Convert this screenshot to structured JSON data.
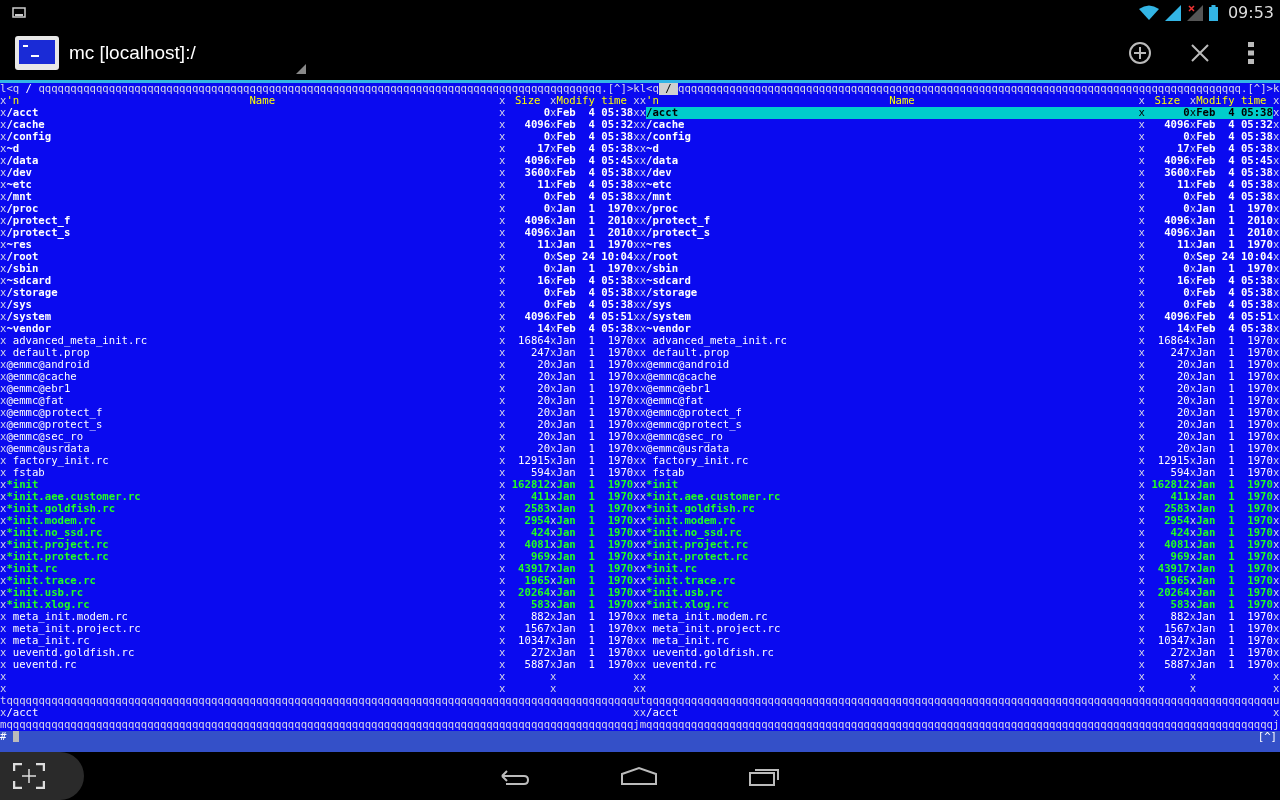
{
  "status_bar": {
    "time": "09:53"
  },
  "app_bar": {
    "title": "mc [localhost]:/"
  },
  "panels": [
    {
      "active": false,
      "top": {
        "start": "l<q",
        "path": "/",
        "rule": "qqqqqqqqqqqqqqqqqqqqqqqqqqqqqqqqqqqqqqqqqqqqqqqqqqqqqqqqqqqqqqqqqqqqqqqqqqqqqqqqqqqqqqqq",
        "end": ".[^]>k"
      },
      "heading": {
        "frame": [
          "x",
          "x",
          "x",
          "x"
        ],
        "sort": "'n",
        "name": "Name",
        "size": "Size",
        "modify": "Modify time"
      },
      "rows": [
        {
          "frame": [
            "x",
            "x",
            "x",
            "x"
          ],
          "name": "/acct",
          "size": "0",
          "date": "Feb  4 05:38",
          "kind": "dir",
          "selected": false
        },
        {
          "frame": [
            "x",
            "x",
            "x",
            "x"
          ],
          "name": "/cache",
          "size": "4096",
          "date": "Feb  4 05:32",
          "kind": "dir",
          "selected": false
        },
        {
          "frame": [
            "x",
            "x",
            "x",
            "x"
          ],
          "name": "/config",
          "size": "0",
          "date": "Feb  4 05:38",
          "kind": "dir",
          "selected": false
        },
        {
          "frame": [
            "x",
            "x",
            "x",
            "x"
          ],
          "name": "~d",
          "size": "17",
          "date": "Feb  4 05:38",
          "kind": "link",
          "selected": false
        },
        {
          "frame": [
            "x",
            "x",
            "x",
            "x"
          ],
          "name": "/data",
          "size": "4096",
          "date": "Feb  4 05:45",
          "kind": "dir",
          "selected": false
        },
        {
          "frame": [
            "x",
            "x",
            "x",
            "x"
          ],
          "name": "/dev",
          "size": "3600",
          "date": "Feb  4 05:38",
          "kind": "dir",
          "selected": false
        },
        {
          "frame": [
            "x",
            "x",
            "x",
            "x"
          ],
          "name": "~etc",
          "size": "11",
          "date": "Feb  4 05:38",
          "kind": "link",
          "selected": false
        },
        {
          "frame": [
            "x",
            "x",
            "x",
            "x"
          ],
          "name": "/mnt",
          "size": "0",
          "date": "Feb  4 05:38",
          "kind": "dir",
          "selected": false
        },
        {
          "frame": [
            "x",
            "x",
            "x",
            "x"
          ],
          "name": "/proc",
          "size": "0",
          "date": "Jan  1  1970",
          "kind": "dir",
          "selected": false
        },
        {
          "frame": [
            "x",
            "x",
            "x",
            "x"
          ],
          "name": "/protect_f",
          "size": "4096",
          "date": "Jan  1  2010",
          "kind": "dir",
          "selected": false
        },
        {
          "frame": [
            "x",
            "x",
            "x",
            "x"
          ],
          "name": "/protect_s",
          "size": "4096",
          "date": "Jan  1  2010",
          "kind": "dir",
          "selected": false
        },
        {
          "frame": [
            "x",
            "x",
            "x",
            "x"
          ],
          "name": "~res",
          "size": "11",
          "date": "Jan  1  1970",
          "kind": "link",
          "selected": false
        },
        {
          "frame": [
            "x",
            "x",
            "x",
            "x"
          ],
          "name": "/root",
          "size": "0",
          "date": "Sep 24 10:04",
          "kind": "dir",
          "selected": false
        },
        {
          "frame": [
            "x",
            "x",
            "x",
            "x"
          ],
          "name": "/sbin",
          "size": "0",
          "date": "Jan  1  1970",
          "kind": "dir",
          "selected": false
        },
        {
          "frame": [
            "x",
            "x",
            "x",
            "x"
          ],
          "name": "~sdcard",
          "size": "16",
          "date": "Feb  4 05:38",
          "kind": "link",
          "selected": false
        },
        {
          "frame": [
            "x",
            "x",
            "x",
            "x"
          ],
          "name": "/storage",
          "size": "0",
          "date": "Feb  4 05:38",
          "kind": "dir",
          "selected": false
        },
        {
          "frame": [
            "x",
            "x",
            "x",
            "x"
          ],
          "name": "/sys",
          "size": "0",
          "date": "Feb  4 05:38",
          "kind": "dir",
          "selected": false
        },
        {
          "frame": [
            "x",
            "x",
            "x",
            "x"
          ],
          "name": "/system",
          "size": "4096",
          "date": "Feb  4 05:51",
          "kind": "dir",
          "selected": false
        },
        {
          "frame": [
            "x",
            "x",
            "x",
            "x"
          ],
          "name": "~vendor",
          "size": "14",
          "date": "Feb  4 05:38",
          "kind": "link",
          "selected": false
        },
        {
          "frame": [
            "x",
            "x",
            "x",
            "x"
          ],
          "name": "advanced_meta_init.rc",
          "size": "16864",
          "date": "Jan  1  1970",
          "kind": "file",
          "selected": false
        },
        {
          "frame": [
            "x",
            "x",
            "x",
            "x"
          ],
          "name": "default.prop",
          "size": "247",
          "date": "Jan  1  1970",
          "kind": "file",
          "selected": false
        },
        {
          "frame": [
            "x",
            "x",
            "x",
            "x"
          ],
          "name": "@emmc@android",
          "size": "20",
          "date": "Jan  1  1970",
          "kind": "device",
          "selected": false
        },
        {
          "frame": [
            "x",
            "x",
            "x",
            "x"
          ],
          "name": "@emmc@cache",
          "size": "20",
          "date": "Jan  1  1970",
          "kind": "device",
          "selected": false
        },
        {
          "frame": [
            "x",
            "x",
            "x",
            "x"
          ],
          "name": "@emmc@ebr1",
          "size": "20",
          "date": "Jan  1  1970",
          "kind": "device",
          "selected": false
        },
        {
          "frame": [
            "x",
            "x",
            "x",
            "x"
          ],
          "name": "@emmc@fat",
          "size": "20",
          "date": "Jan  1  1970",
          "kind": "device",
          "selected": false
        },
        {
          "frame": [
            "x",
            "x",
            "x",
            "x"
          ],
          "name": "@emmc@protect_f",
          "size": "20",
          "date": "Jan  1  1970",
          "kind": "device",
          "selected": false
        },
        {
          "frame": [
            "x",
            "x",
            "x",
            "x"
          ],
          "name": "@emmc@protect_s",
          "size": "20",
          "date": "Jan  1  1970",
          "kind": "device",
          "selected": false
        },
        {
          "frame": [
            "x",
            "x",
            "x",
            "x"
          ],
          "name": "@emmc@sec_ro",
          "size": "20",
          "date": "Jan  1  1970",
          "kind": "device",
          "selected": false
        },
        {
          "frame": [
            "x",
            "x",
            "x",
            "x"
          ],
          "name": "@emmc@usrdata",
          "size": "20",
          "date": "Jan  1  1970",
          "kind": "device",
          "selected": false
        },
        {
          "frame": [
            "x",
            "x",
            "x",
            "x"
          ],
          "name": "factory_init.rc",
          "size": "12915",
          "date": "Jan  1  1970",
          "kind": "file",
          "selected": false
        },
        {
          "frame": [
            "x",
            "x",
            "x",
            "x"
          ],
          "name": "fstab",
          "size": "594",
          "date": "Jan  1  1970",
          "kind": "file",
          "selected": false
        },
        {
          "frame": [
            "x",
            "x",
            "x",
            "x"
          ],
          "name": "*init",
          "size": "162812",
          "date": "Jan  1  1970",
          "kind": "exec",
          "selected": false
        },
        {
          "frame": [
            "x",
            "x",
            "x",
            "x"
          ],
          "name": "*init.aee.customer.rc",
          "size": "411",
          "date": "Jan  1  1970",
          "kind": "exec",
          "selected": false
        },
        {
          "frame": [
            "x",
            "x",
            "x",
            "x"
          ],
          "name": "*init.goldfish.rc",
          "size": "2583",
          "date": "Jan  1  1970",
          "kind": "exec",
          "selected": false
        },
        {
          "frame": [
            "x",
            "x",
            "x",
            "x"
          ],
          "name": "*init.modem.rc",
          "size": "2954",
          "date": "Jan  1  1970",
          "kind": "exec",
          "selected": false
        },
        {
          "frame": [
            "x",
            "x",
            "x",
            "x"
          ],
          "name": "*init.no_ssd.rc",
          "size": "424",
          "date": "Jan  1  1970",
          "kind": "exec",
          "selected": false
        },
        {
          "frame": [
            "x",
            "x",
            "x",
            "x"
          ],
          "name": "*init.project.rc",
          "size": "4081",
          "date": "Jan  1  1970",
          "kind": "exec",
          "selected": false
        },
        {
          "frame": [
            "x",
            "x",
            "x",
            "x"
          ],
          "name": "*init.protect.rc",
          "size": "969",
          "date": "Jan  1  1970",
          "kind": "exec",
          "selected": false
        },
        {
          "frame": [
            "x",
            "x",
            "x",
            "x"
          ],
          "name": "*init.rc",
          "size": "43917",
          "date": "Jan  1  1970",
          "kind": "exec",
          "selected": false
        },
        {
          "frame": [
            "x",
            "x",
            "x",
            "x"
          ],
          "name": "*init.trace.rc",
          "size": "1965",
          "date": "Jan  1  1970",
          "kind": "exec",
          "selected": false
        },
        {
          "frame": [
            "x",
            "x",
            "x",
            "x"
          ],
          "name": "*init.usb.rc",
          "size": "20264",
          "date": "Jan  1  1970",
          "kind": "exec",
          "selected": false
        },
        {
          "frame": [
            "x",
            "x",
            "x",
            "x"
          ],
          "name": "*init.xlog.rc",
          "size": "583",
          "date": "Jan  1  1970",
          "kind": "exec",
          "selected": false
        },
        {
          "frame": [
            "x",
            "x",
            "x",
            "x"
          ],
          "name": "meta_init.modem.rc",
          "size": "882",
          "date": "Jan  1  1970",
          "kind": "file",
          "selected": false
        },
        {
          "frame": [
            "x",
            "x",
            "x",
            "x"
          ],
          "name": "meta_init.project.rc",
          "size": "1567",
          "date": "Jan  1  1970",
          "kind": "file",
          "selected": false
        },
        {
          "frame": [
            "x",
            "x",
            "x",
            "x"
          ],
          "name": "meta_init.rc",
          "size": "10347",
          "date": "Jan  1  1970",
          "kind": "file",
          "selected": false
        },
        {
          "frame": [
            "x",
            "x",
            "x",
            "x"
          ],
          "name": "ueventd.goldfish.rc",
          "size": "272",
          "date": "Jan  1  1970",
          "kind": "file",
          "selected": false
        },
        {
          "frame": [
            "x",
            "x",
            "x",
            "x"
          ],
          "name": "ueventd.rc",
          "size": "5887",
          "date": "Jan  1  1970",
          "kind": "file",
          "selected": false
        }
      ],
      "blank_rows": [
        {
          "frame": [
            "x",
            "x",
            "x",
            "x"
          ]
        },
        {
          "frame": [
            "x",
            "x",
            "x",
            "x"
          ]
        }
      ],
      "divider": {
        "start": "t",
        "rule": "qqqqqqqqqqqqqqqqqqqqqqqqqqqqqqqqqqqqqqqqqqqqqqqqqqqqqqqqqqqqqqqqqqqqqqqqqqqqqqqqqqqqqqqqqqqqqqqqqq",
        "end": "u"
      },
      "info": {
        "frame": [
          "x",
          "x"
        ],
        "text": "/acct"
      },
      "bottom": {
        "start": "m",
        "rule": "qqqqqqqqqqqqqqqqqqqqqqqqqqqqqqqqqqqqqqqqqqqqqqqqqqqqqqqqqqqqqqqqqqqqqqqqqqqqqqqqqqqqqqqqqqqqqqqqqq",
        "end": "j"
      }
    },
    {
      "active": true,
      "top": {
        "start": "l<q",
        "path": "/",
        "rule": "qqqqqqqqqqqqqqqqqqqqqqqqqqqqqqqqqqqqqqqqqqqqqqqqqqqqqqqqqqqqqqqqqqqqqqqqqqqqqqqqqqqqqqqq",
        "end": ".[^]>k"
      },
      "heading": {
        "frame": [
          "x",
          "x",
          "x",
          "x"
        ],
        "sort": "'n",
        "name": "Name",
        "size": "Size",
        "modify": "Modify time"
      },
      "rows": [
        {
          "frame": [
            "x",
            "x",
            "x",
            "x"
          ],
          "name": "/acct",
          "size": "0",
          "date": "Feb  4 05:38",
          "kind": "dir",
          "selected": true
        },
        {
          "frame": [
            "x",
            "x",
            "x",
            "x"
          ],
          "name": "/cache",
          "size": "4096",
          "date": "Feb  4 05:32",
          "kind": "dir",
          "selected": false
        },
        {
          "frame": [
            "x",
            "x",
            "x",
            "x"
          ],
          "name": "/config",
          "size": "0",
          "date": "Feb  4 05:38",
          "kind": "dir",
          "selected": false
        },
        {
          "frame": [
            "x",
            "x",
            "x",
            "x"
          ],
          "name": "~d",
          "size": "17",
          "date": "Feb  4 05:38",
          "kind": "link",
          "selected": false
        },
        {
          "frame": [
            "x",
            "x",
            "x",
            "x"
          ],
          "name": "/data",
          "size": "4096",
          "date": "Feb  4 05:45",
          "kind": "dir",
          "selected": false
        },
        {
          "frame": [
            "x",
            "x",
            "x",
            "x"
          ],
          "name": "/dev",
          "size": "3600",
          "date": "Feb  4 05:38",
          "kind": "dir",
          "selected": false
        },
        {
          "frame": [
            "x",
            "x",
            "x",
            "x"
          ],
          "name": "~etc",
          "size": "11",
          "date": "Feb  4 05:38",
          "kind": "link",
          "selected": false
        },
        {
          "frame": [
            "x",
            "x",
            "x",
            "x"
          ],
          "name": "/mnt",
          "size": "0",
          "date": "Feb  4 05:38",
          "kind": "dir",
          "selected": false
        },
        {
          "frame": [
            "x",
            "x",
            "x",
            "x"
          ],
          "name": "/proc",
          "size": "0",
          "date": "Jan  1  1970",
          "kind": "dir",
          "selected": false
        },
        {
          "frame": [
            "x",
            "x",
            "x",
            "x"
          ],
          "name": "/protect_f",
          "size": "4096",
          "date": "Jan  1  2010",
          "kind": "dir",
          "selected": false
        },
        {
          "frame": [
            "x",
            "x",
            "x",
            "x"
          ],
          "name": "/protect_s",
          "size": "4096",
          "date": "Jan  1  2010",
          "kind": "dir",
          "selected": false
        },
        {
          "frame": [
            "x",
            "x",
            "x",
            "x"
          ],
          "name": "~res",
          "size": "11",
          "date": "Jan  1  1970",
          "kind": "link",
          "selected": false
        },
        {
          "frame": [
            "x",
            "x",
            "x",
            "x"
          ],
          "name": "/root",
          "size": "0",
          "date": "Sep 24 10:04",
          "kind": "dir",
          "selected": false
        },
        {
          "frame": [
            "x",
            "x",
            "x",
            "x"
          ],
          "name": "/sbin",
          "size": "0",
          "date": "Jan  1  1970",
          "kind": "dir",
          "selected": false
        },
        {
          "frame": [
            "x",
            "x",
            "x",
            "x"
          ],
          "name": "~sdcard",
          "size": "16",
          "date": "Feb  4 05:38",
          "kind": "link",
          "selected": false
        },
        {
          "frame": [
            "x",
            "x",
            "x",
            "x"
          ],
          "name": "/storage",
          "size": "0",
          "date": "Feb  4 05:38",
          "kind": "dir",
          "selected": false
        },
        {
          "frame": [
            "x",
            "x",
            "x",
            "x"
          ],
          "name": "/sys",
          "size": "0",
          "date": "Feb  4 05:38",
          "kind": "dir",
          "selected": false
        },
        {
          "frame": [
            "x",
            "x",
            "x",
            "x"
          ],
          "name": "/system",
          "size": "4096",
          "date": "Feb  4 05:51",
          "kind": "dir",
          "selected": false
        },
        {
          "frame": [
            "x",
            "x",
            "x",
            "x"
          ],
          "name": "~vendor",
          "size": "14",
          "date": "Feb  4 05:38",
          "kind": "link",
          "selected": false
        },
        {
          "frame": [
            "x",
            "x",
            "x",
            "x"
          ],
          "name": "advanced_meta_init.rc",
          "size": "16864",
          "date": "Jan  1  1970",
          "kind": "file",
          "selected": false
        },
        {
          "frame": [
            "x",
            "x",
            "x",
            "x"
          ],
          "name": "default.prop",
          "size": "247",
          "date": "Jan  1  1970",
          "kind": "file",
          "selected": false
        },
        {
          "frame": [
            "x",
            "x",
            "x",
            "x"
          ],
          "name": "@emmc@android",
          "size": "20",
          "date": "Jan  1  1970",
          "kind": "device",
          "selected": false
        },
        {
          "frame": [
            "x",
            "x",
            "x",
            "x"
          ],
          "name": "@emmc@cache",
          "size": "20",
          "date": "Jan  1  1970",
          "kind": "device",
          "selected": false
        },
        {
          "frame": [
            "x",
            "x",
            "x",
            "x"
          ],
          "name": "@emmc@ebr1",
          "size": "20",
          "date": "Jan  1  1970",
          "kind": "device",
          "selected": false
        },
        {
          "frame": [
            "x",
            "x",
            "x",
            "x"
          ],
          "name": "@emmc@fat",
          "size": "20",
          "date": "Jan  1  1970",
          "kind": "device",
          "selected": false
        },
        {
          "frame": [
            "x",
            "x",
            "x",
            "x"
          ],
          "name": "@emmc@protect_f",
          "size": "20",
          "date": "Jan  1  1970",
          "kind": "device",
          "selected": false
        },
        {
          "frame": [
            "x",
            "x",
            "x",
            "x"
          ],
          "name": "@emmc@protect_s",
          "size": "20",
          "date": "Jan  1  1970",
          "kind": "device",
          "selected": false
        },
        {
          "frame": [
            "x",
            "x",
            "x",
            "x"
          ],
          "name": "@emmc@sec_ro",
          "size": "20",
          "date": "Jan  1  1970",
          "kind": "device",
          "selected": false
        },
        {
          "frame": [
            "x",
            "x",
            "x",
            "x"
          ],
          "name": "@emmc@usrdata",
          "size": "20",
          "date": "Jan  1  1970",
          "kind": "device",
          "selected": false
        },
        {
          "frame": [
            "x",
            "x",
            "x",
            "x"
          ],
          "name": "factory_init.rc",
          "size": "12915",
          "date": "Jan  1  1970",
          "kind": "file",
          "selected": false
        },
        {
          "frame": [
            "x",
            "x",
            "x",
            "x"
          ],
          "name": "fstab",
          "size": "594",
          "date": "Jan  1  1970",
          "kind": "file",
          "selected": false
        },
        {
          "frame": [
            "x",
            "x",
            "x",
            "x"
          ],
          "name": "*init",
          "size": "162812",
          "date": "Jan  1  1970",
          "kind": "exec",
          "selected": false
        },
        {
          "frame": [
            "x",
            "x",
            "x",
            "x"
          ],
          "name": "*init.aee.customer.rc",
          "size": "411",
          "date": "Jan  1  1970",
          "kind": "exec",
          "selected": false
        },
        {
          "frame": [
            "x",
            "x",
            "x",
            "x"
          ],
          "name": "*init.goldfish.rc",
          "size": "2583",
          "date": "Jan  1  1970",
          "kind": "exec",
          "selected": false
        },
        {
          "frame": [
            "x",
            "x",
            "x",
            "x"
          ],
          "name": "*init.modem.rc",
          "size": "2954",
          "date": "Jan  1  1970",
          "kind": "exec",
          "selected": false
        },
        {
          "frame": [
            "x",
            "x",
            "x",
            "x"
          ],
          "name": "*init.no_ssd.rc",
          "size": "424",
          "date": "Jan  1  1970",
          "kind": "exec",
          "selected": false
        },
        {
          "frame": [
            "x",
            "x",
            "x",
            "x"
          ],
          "name": "*init.project.rc",
          "size": "4081",
          "date": "Jan  1  1970",
          "kind": "exec",
          "selected": false
        },
        {
          "frame": [
            "x",
            "x",
            "x",
            "x"
          ],
          "name": "*init.protect.rc",
          "size": "969",
          "date": "Jan  1  1970",
          "kind": "exec",
          "selected": false
        },
        {
          "frame": [
            "x",
            "x",
            "x",
            "x"
          ],
          "name": "*init.rc",
          "size": "43917",
          "date": "Jan  1  1970",
          "kind": "exec",
          "selected": false
        },
        {
          "frame": [
            "x",
            "x",
            "x",
            "x"
          ],
          "name": "*init.trace.rc",
          "size": "1965",
          "date": "Jan  1  1970",
          "kind": "exec",
          "selected": false
        },
        {
          "frame": [
            "x",
            "x",
            "x",
            "x"
          ],
          "name": "*init.usb.rc",
          "size": "20264",
          "date": "Jan  1  1970",
          "kind": "exec",
          "selected": false
        },
        {
          "frame": [
            "x",
            "x",
            "x",
            "x"
          ],
          "name": "*init.xlog.rc",
          "size": "583",
          "date": "Jan  1  1970",
          "kind": "exec",
          "selected": false
        },
        {
          "frame": [
            "x",
            "x",
            "x",
            "x"
          ],
          "name": "meta_init.modem.rc",
          "size": "882",
          "date": "Jan  1  1970",
          "kind": "file",
          "selected": false
        },
        {
          "frame": [
            "x",
            "x",
            "x",
            "x"
          ],
          "name": "meta_init.project.rc",
          "size": "1567",
          "date": "Jan  1  1970",
          "kind": "file",
          "selected": false
        },
        {
          "frame": [
            "x",
            "x",
            "x",
            "x"
          ],
          "name": "meta_init.rc",
          "size": "10347",
          "date": "Jan  1  1970",
          "kind": "file",
          "selected": false
        },
        {
          "frame": [
            "x",
            "x",
            "x",
            "x"
          ],
          "name": "ueventd.goldfish.rc",
          "size": "272",
          "date": "Jan  1  1970",
          "kind": "file",
          "selected": false
        },
        {
          "frame": [
            "x",
            "x",
            "x",
            "x"
          ],
          "name": "ueventd.rc",
          "size": "5887",
          "date": "Jan  1  1970",
          "kind": "file",
          "selected": false
        }
      ],
      "blank_rows": [
        {
          "frame": [
            "x",
            "x",
            "x",
            "x"
          ]
        },
        {
          "frame": [
            "x",
            "x",
            "x",
            "x"
          ]
        }
      ],
      "divider": {
        "start": "t",
        "rule": "qqqqqqqqqqqqqqqqqqqqqqqqqqqqqqqqqqqqqqqqqqqqqqqqqqqqqqqqqqqqqqqqqqqqqqqqqqqqqqqqqqqqqqqqqqqqqqqqqq",
        "end": "u"
      },
      "info": {
        "frame": [
          "x",
          "x"
        ],
        "text": "/acct"
      },
      "bottom": {
        "start": "m",
        "rule": "qqqqqqqqqqqqqqqqqqqqqqqqqqqqqqqqqqqqqqqqqqqqqqqqqqqqqqqqqqqqqqqqqqqqqqqqqqqqqqqqqqqqqqqqqqqqqqqqqq",
        "end": "j"
      }
    }
  ],
  "command_line": {
    "prompt": "#",
    "hint": "[^]"
  }
}
